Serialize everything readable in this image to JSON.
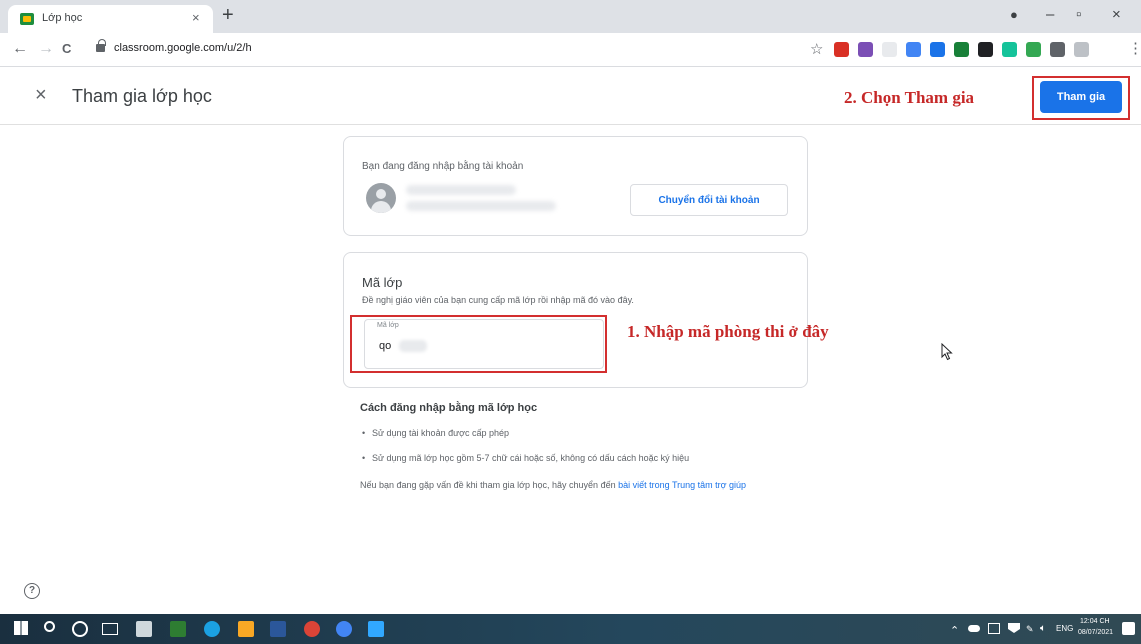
{
  "browser": {
    "tab_title": "Lớp học",
    "tab_close": "×",
    "new_tab": "+",
    "url": "classroom.google.com/u/2/h",
    "window_controls": {
      "profile": "●",
      "minimize": "–",
      "maximize": "▫",
      "close": "×"
    },
    "nav": {
      "back": "←",
      "forward": "→",
      "reload": "C"
    },
    "star": "☆",
    "menu": "⋮",
    "extensions": [
      {
        "name": "gift-extension-icon",
        "color": "#d93025"
      },
      {
        "name": "puzzle-extension-icon",
        "color": "#7b4fb5"
      },
      {
        "name": "blank-extension-icon",
        "color": "#e8eaed"
      },
      {
        "name": "dot-extension-icon",
        "color": "#4285f4"
      },
      {
        "name": "docs-extension-icon",
        "color": "#1a73e8"
      },
      {
        "name": "paint-extension-icon",
        "color": "#188038"
      },
      {
        "name": "pen-extension-icon",
        "color": "#202124"
      },
      {
        "name": "grammarly-extension-icon",
        "color": "#15c39a"
      },
      {
        "name": "asterisk-extension-icon",
        "color": "#34a853"
      },
      {
        "name": "extensions-puzzle-icon",
        "color": "#5f6368"
      },
      {
        "name": "profile-avatar-icon",
        "color": "#bdc1c6"
      }
    ]
  },
  "header": {
    "close": "×",
    "title": "Tham gia lớp học",
    "join_button": "Tham gia"
  },
  "account_card": {
    "label": "Bạn đang đăng nhập bằng tài khoản",
    "switch_button": "Chuyển đổi tài khoản"
  },
  "code_card": {
    "heading": "Mã lớp",
    "description": "Đề nghị giáo viên của bạn cung cấp mã lớp rồi nhập mã đó vào đây.",
    "field_label": "Mã lớp",
    "field_value": "qo"
  },
  "help": {
    "heading": "Cách đăng nhập bằng mã lớp học",
    "items": [
      "Sử dụng tài khoản được cấp phép",
      "Sử dụng mã lớp học gồm 5-7 chữ cái hoặc số, không có dấu cách hoặc ký hiệu"
    ],
    "note_prefix": "Nếu bạn đang gặp vấn đề khi tham gia lớp học, hãy chuyển đến ",
    "note_link": "bài viết trong Trung tâm trợ giúp"
  },
  "annotations": {
    "step1": "1. Nhập mã phòng thi ở đây",
    "step2": "2. Chọn Tham gia",
    "color": "#c62828"
  },
  "help_button": "?",
  "taskbar": {
    "language": "ENG",
    "time": "12:04 CH",
    "date": "08/07/2021",
    "apps": [
      {
        "name": "windows-start-icon",
        "color": "#ffffff"
      },
      {
        "name": "search-icon",
        "color": "#ffffff"
      },
      {
        "name": "cortana-icon",
        "color": "#ffffff"
      },
      {
        "name": "task-view-icon",
        "color": "#ffffff"
      },
      {
        "name": "monitor-app-icon",
        "color": "#cfd8dc"
      },
      {
        "name": "files-app-icon",
        "color": "#2e7d32"
      },
      {
        "name": "edge-icon",
        "color": "#1ba1e2"
      },
      {
        "name": "file-explorer-icon",
        "color": "#f9a825"
      },
      {
        "name": "word-icon",
        "color": "#2b579a"
      },
      {
        "name": "chrome-icon",
        "color": "#db4437"
      },
      {
        "name": "chrome-profile-icon",
        "color": "#4285f4"
      },
      {
        "name": "photoshop-icon",
        "color": "#31a8ff"
      }
    ]
  }
}
